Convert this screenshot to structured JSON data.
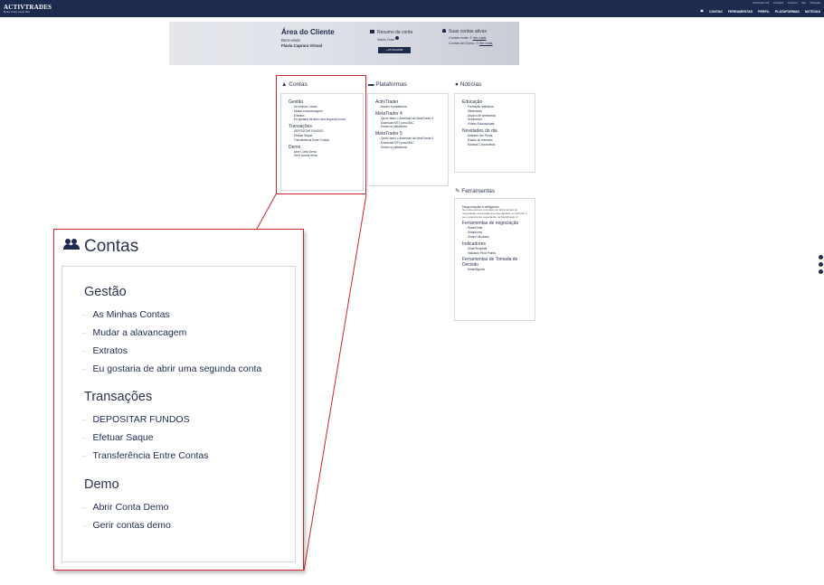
{
  "header": {
    "logo": "ACTIVTRADES",
    "logo_tagline": "Broker Online desde 2001",
    "utility_links": [
      "Chat Online 24h",
      "Contactos",
      "Conhecer",
      "Sair",
      "Português"
    ],
    "nav": [
      "CONTAS",
      "FERRAMENTAS",
      "PERFIL",
      "PLATAFORMAS",
      "NOTÍCIAS"
    ]
  },
  "hero": {
    "title": "Área do Cliente",
    "welcome": "Bem-vindo",
    "user_name": "Flavia Caprara Virtual",
    "summary_title": "Resumo da conta",
    "balance_label": "Saldo Total",
    "update_button": "ATUALIZAR",
    "active_title": "Suas contas ativas",
    "real_accounts": "Contas reais: 4",
    "demo_accounts": "Contas de Demo: 3",
    "view_more": "Ver mais"
  },
  "contas": {
    "title": "Contas",
    "groups": [
      {
        "heading": "Gestão",
        "items": [
          "As Minhas Contas",
          "Mudar a alavancagem",
          "Extratos",
          "Eu gostaria de abrir uma segunda conta"
        ]
      },
      {
        "heading": "Transações",
        "items": [
          "DEPOSITAR FUNDOS",
          "Efetuar Saque",
          "Transferência Entre Contas"
        ]
      },
      {
        "heading": "Demo",
        "items": [
          "Abrir Conta Demo",
          "Gerir contas demo"
        ]
      }
    ]
  },
  "plataformas": {
    "title": "Plataformas",
    "groups": [
      {
        "heading": "ActivTrader",
        "items": [
          "Aceder à plataforma"
        ]
      },
      {
        "heading": "MetaTrader 4",
        "items": [
          "Quero fazer o download da MetaTrader 4",
          "Download MT4 para MAC",
          "Entrar na plataforma"
        ]
      },
      {
        "heading": "MetaTrader 5",
        "items": [
          "Quero fazer o download da MetaTrader 5",
          "Download MT5 para MAC",
          "Entrar na plataforma"
        ]
      }
    ]
  },
  "noticias": {
    "title": "Notícias",
    "groups": [
      {
        "heading": "Educação",
        "items": [
          "Formação individual",
          "Webinários",
          "Arquivo de webinários",
          "Seminários",
          "Vídeos Educacionais"
        ]
      },
      {
        "heading": "Novidades do dia",
        "items": [
          "Análises dos Pivots",
          "Estado do mercado",
          "Notícias Corporativas"
        ]
      }
    ]
  },
  "ferramentas": {
    "title": "Ferramentas",
    "intro_heading": "Negociação Inteligente",
    "intro_text": "Nós oferecemos uma série de ferramentas de negociação avançadas que irão ajudá-lo a melhorar o seu potencial de negociação na MetaTrader 4.",
    "groups": [
      {
        "heading": "Ferramentas de negociação",
        "items": [
          "SmartOrder",
          "SmartLines",
          "Smart Calculator"
        ]
      },
      {
        "heading": "Indicadores",
        "items": [
          "SmartTemplate",
          "Indicador Pivot Points"
        ]
      },
      {
        "heading": "Ferramentas de Tomada de Decisão",
        "items": [
          "SmartSignals"
        ]
      }
    ]
  }
}
